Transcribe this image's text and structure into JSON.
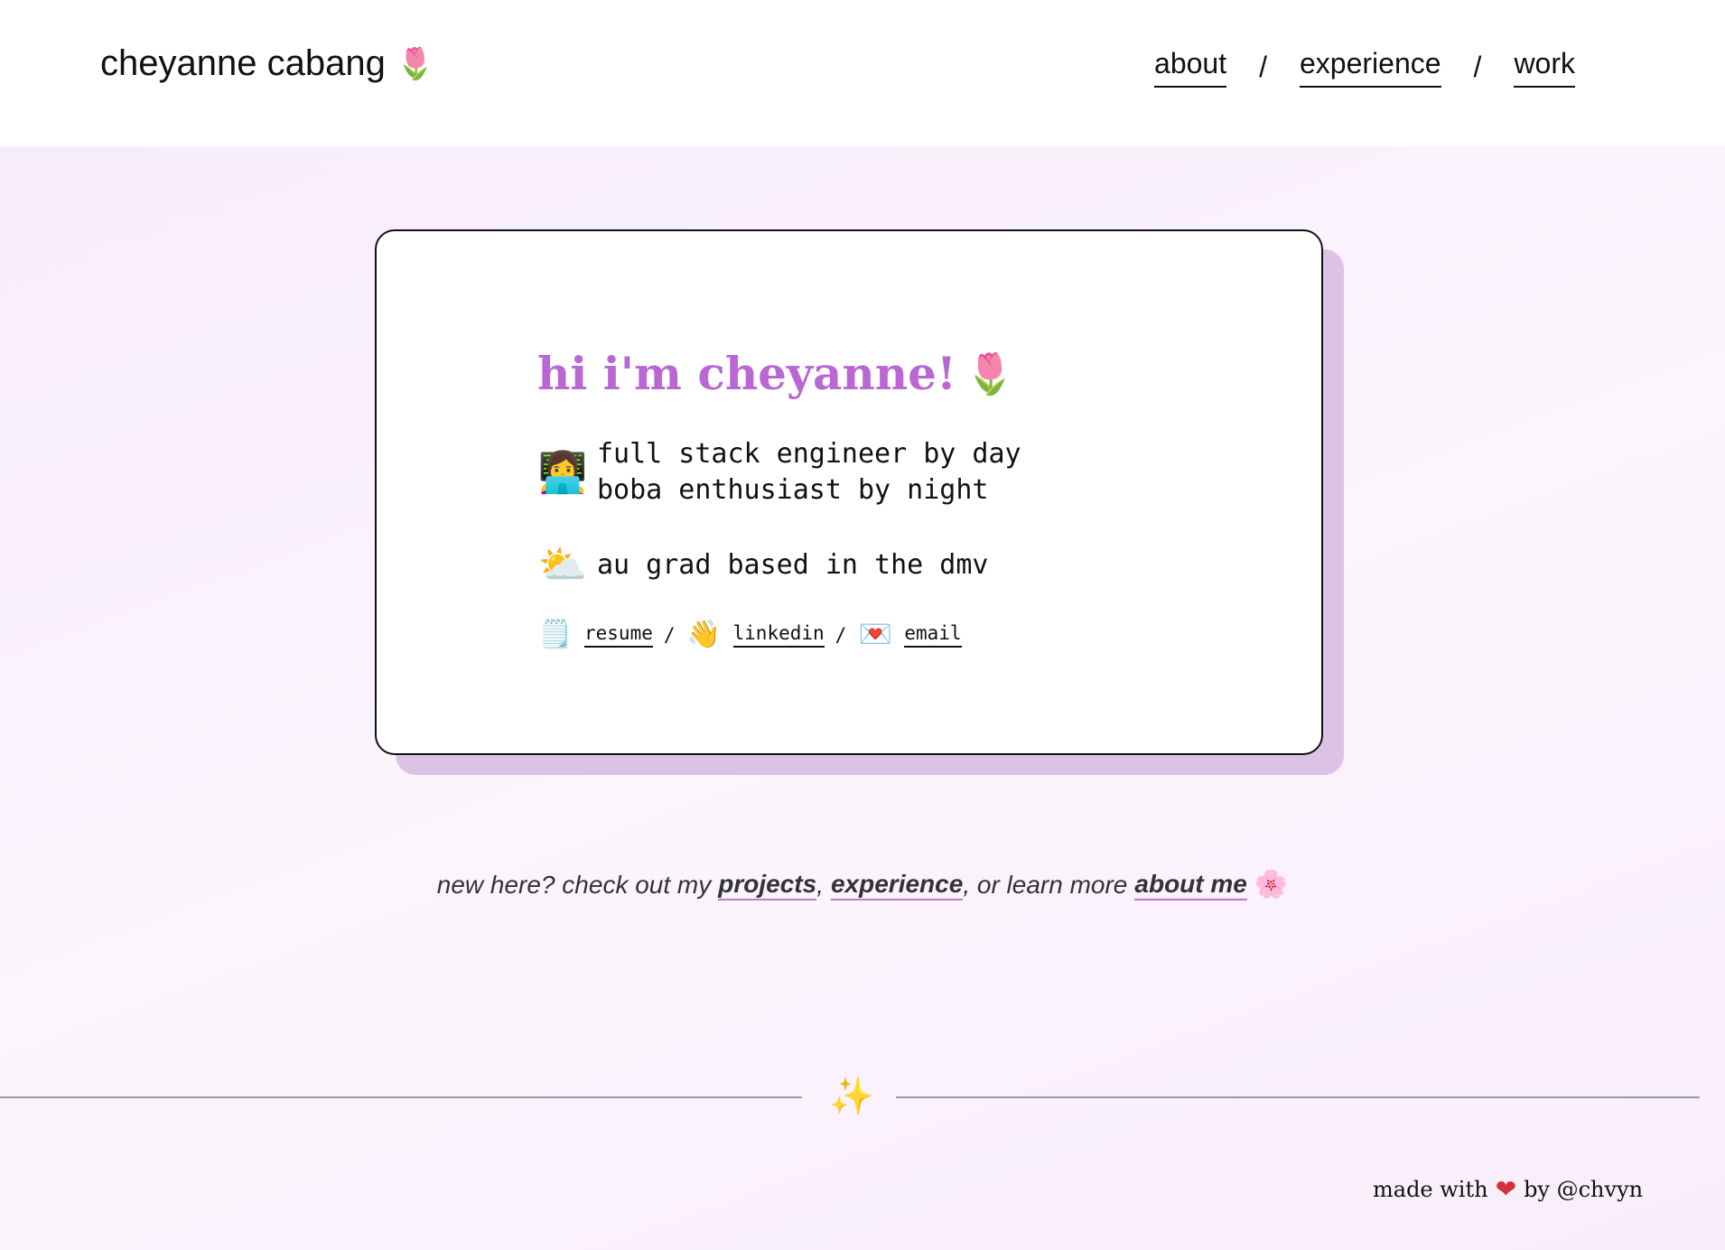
{
  "header": {
    "brand": "cheyanne cabang",
    "brand_icon": "tulip-icon",
    "nav": [
      {
        "label": "about"
      },
      {
        "label": "experience"
      },
      {
        "label": "work"
      }
    ],
    "nav_separator": "/"
  },
  "card": {
    "greeting": "hi i'm cheyanne!",
    "greeting_icon": "tulip-icon",
    "line1": "full stack engineer by day",
    "line2": "boba enthusiast by night",
    "lines_icon": "woman-technologist-icon",
    "location": "au grad based in the dmv",
    "location_icon": "sun-behind-cloud-icon",
    "links": [
      {
        "label": "resume",
        "icon": "notepad-icon"
      },
      {
        "label": "linkedin",
        "icon": "waving-hand-icon"
      },
      {
        "label": "email",
        "icon": "love-letter-icon"
      }
    ],
    "link_separator": "/"
  },
  "tagline": {
    "prefix": "new here? check out my",
    "link1": "projects",
    "comma": ",",
    "link2": "experience",
    "middle": ", or learn more",
    "link3": "about me",
    "icon": "cherry-blossom-icon"
  },
  "divider_icon": "sparkles-icon",
  "footer": {
    "prefix": "made with",
    "suffix": "by @chvyn",
    "icon": "red-heart-icon"
  },
  "colors": {
    "accent": "#b968d3",
    "card_shadow": "#dcc2e5",
    "underline": "#c673c8",
    "background": "#f8eefb"
  }
}
